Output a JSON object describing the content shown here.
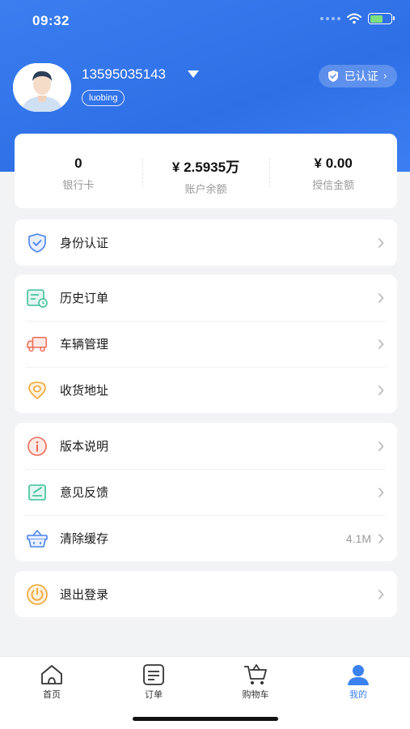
{
  "status": {
    "time": "09:32"
  },
  "profile": {
    "phone": "13595035143",
    "nickname": "luobing",
    "verified_label": "已认证"
  },
  "stats": [
    {
      "value": "0",
      "label": "银行卡"
    },
    {
      "value": "¥ 2.5935万",
      "label": "账户余额"
    },
    {
      "value": "¥ 0.00",
      "label": "授信金额"
    }
  ],
  "menu": {
    "identity": {
      "label": "身份认证",
      "icon": "shield-check-icon"
    },
    "orders": {
      "label": "历史订单",
      "icon": "order-history-icon"
    },
    "vehicles": {
      "label": "车辆管理",
      "icon": "truck-icon"
    },
    "address": {
      "label": "收货地址",
      "icon": "location-pin-icon"
    },
    "version": {
      "label": "版本说明",
      "icon": "info-icon"
    },
    "feedback": {
      "label": "意见反馈",
      "icon": "feedback-icon"
    },
    "cache": {
      "label": "清除缓存",
      "value": "4.1M",
      "icon": "basket-icon"
    },
    "logout": {
      "label": "退出登录",
      "icon": "power-icon"
    }
  },
  "tabs": [
    {
      "label": "首页",
      "icon": "home-icon"
    },
    {
      "label": "订单",
      "icon": "order-icon"
    },
    {
      "label": "购物车",
      "icon": "cart-icon"
    },
    {
      "label": "我的",
      "icon": "user-icon",
      "active": true
    }
  ],
  "colors": {
    "primary": "#3b82f0",
    "header": "#2f6fe6",
    "background": "#f2f3f5"
  }
}
